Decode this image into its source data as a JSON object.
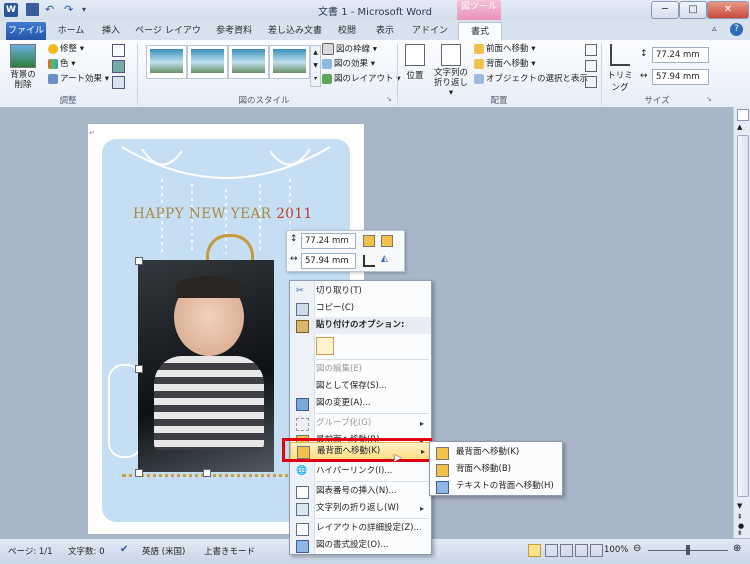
{
  "window": {
    "title": "文書 1 - Microsoft Word",
    "controls": [
      "─",
      "□",
      "✕"
    ]
  },
  "tool_tab": "図ツール",
  "tabs": [
    {
      "label": "ファイル"
    },
    {
      "label": "ホーム"
    },
    {
      "label": "挿入"
    },
    {
      "label": "ページ レイアウト"
    },
    {
      "label": "参考資料"
    },
    {
      "label": "差し込み文書"
    },
    {
      "label": "校閲"
    },
    {
      "label": "表示"
    },
    {
      "label": "アドイン"
    },
    {
      "label": "書式"
    }
  ],
  "ribbon": {
    "adjust": {
      "remove_bg": "背景の削除",
      "corrections": "修整 ▾",
      "color": "色 ▾",
      "artistic": "アート効果 ▾",
      "label": "調整"
    },
    "styles": {
      "border": "図の枠線 ▾",
      "effects": "図の効果 ▾",
      "layout": "図のレイアウト ▾",
      "label": "図のスタイル"
    },
    "arrange": {
      "position": "位置",
      "wrap": "文字列の折り返し ▾",
      "front": "前面へ移動 ▾",
      "back": "背面へ移動 ▾",
      "selection": "オブジェクトの選択と表示",
      "label": "配置"
    },
    "size": {
      "crop": "トリミング",
      "height": "77.24 mm",
      "width": "57.94 mm",
      "label": "サイズ"
    }
  },
  "document": {
    "greeting_main": "HAPPY NEW YEAR",
    "greeting_year": "2011",
    "colors": {
      "card": "#c5def3",
      "greeting": "#a88a40",
      "year": "#c0392b"
    }
  },
  "mini_toolbar": {
    "height": "77.24 mm",
    "width": "57.94 mm"
  },
  "context_menu": {
    "cut": "切り取り(T)",
    "copy": "コピー(C)",
    "paste_options": "貼り付けのオプション:",
    "edit_picture": "図の編集(E)",
    "save_as_picture": "図として保存(S)...",
    "change_picture": "図の変更(A)...",
    "group": "グループ化(G)",
    "bring_forward": "最前面へ移動(R)",
    "send_to_back": "最背面へ移動(K)",
    "hyperlink": "ハイパーリンク(I)...",
    "insert_caption": "図表番号の挿入(N)...",
    "text_wrapping": "文字列の折り返し(W)",
    "layout_details": "レイアウトの詳細設定(Z)...",
    "format_picture": "図の書式設定(O)..."
  },
  "submenu": {
    "send_to_back": "最背面へ移動(K)",
    "send_backward": "背面へ移動(B)",
    "behind_text": "テキストの背面へ移動(H)"
  },
  "status": {
    "page": "ページ: 1/1",
    "words": "文字数: 0",
    "language": "英語 (米国)",
    "mode": "上書きモード",
    "zoom": "100%"
  }
}
